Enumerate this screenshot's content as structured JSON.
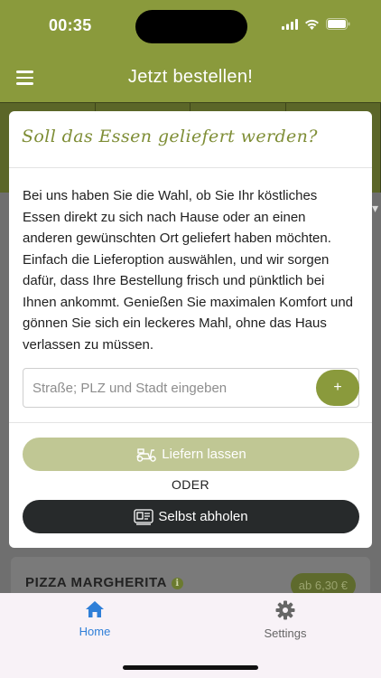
{
  "status_bar": {
    "time": "00:35"
  },
  "header": {
    "title": "Jetzt bestellen!"
  },
  "modal": {
    "title": "Soll das Essen geliefert werden?",
    "body_text": "Bei uns haben Sie die Wahl, ob Sie Ihr köstliches Essen direkt zu sich nach Hause oder an einen anderen gewünschten Ort geliefert haben möchten. Einfach die Lieferoption auswählen, und wir sorgen dafür, dass Ihre Bestellung frisch und pünktlich bei Ihnen ankommt. Genießen Sie maximalen Komfort und gönnen Sie sich ein leckeres Mahl, ohne das Haus verlassen zu müssen.",
    "address_input": {
      "value": "",
      "placeholder": "Straße; PLZ und Stadt eingeben"
    },
    "add_button_label": "+",
    "deliver_button_label": "Liefern lassen",
    "separator_label": "ODER",
    "pickup_button_label": "Selbst abholen"
  },
  "menu_item": {
    "name": "PIZZA MARGHERITA",
    "info_icon_label": "i",
    "price": "ab 6,30 €"
  },
  "tabbar": {
    "tabs": [
      {
        "label": "Home",
        "icon": "home-icon",
        "active": true
      },
      {
        "label": "Settings",
        "icon": "gear-icon",
        "active": false
      }
    ]
  },
  "colors": {
    "brand_green": "#8a9a3c",
    "tab_active_blue": "#2f7fd8",
    "pickup_button_dark": "#272a2b",
    "deliver_button_light": "#c0c794"
  }
}
